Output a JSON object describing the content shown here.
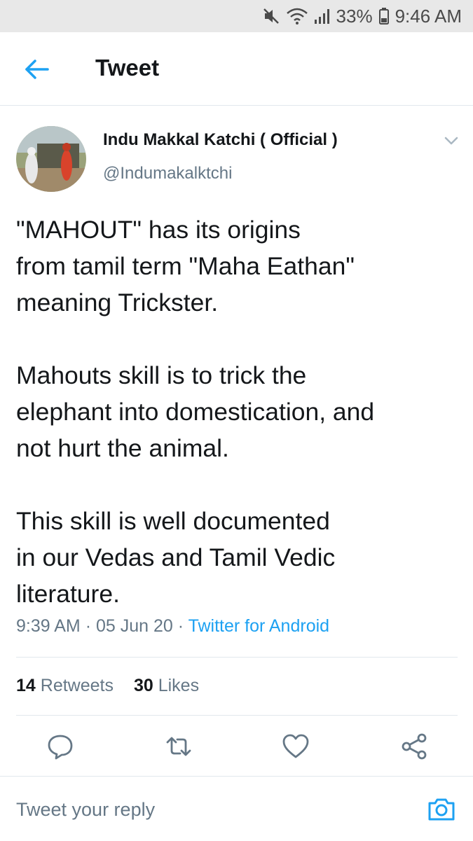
{
  "status_bar": {
    "battery": "33%",
    "time": "9:46 AM",
    "icons": [
      "mute-icon",
      "wifi-icon",
      "signal-icon",
      "battery-icon"
    ]
  },
  "header": {
    "title": "Tweet",
    "back_icon": "back-arrow-icon"
  },
  "tweet": {
    "author_name": "Indu Makkal Katchi ( Official )",
    "handle": "@Indumakalktchi",
    "paragraphs": [
      "\"MAHOUT\" has its origins\nfrom tamil term \"Maha Eathan\"\nmeaning Trickster.",
      "Mahouts skill is to trick the\nelephant into domestication, and\nnot hurt the animal.",
      "This skill is well documented\nin our Vedas and Tamil Vedic\nliterature."
    ],
    "time": "9:39 AM",
    "date": "05 Jun 20",
    "separator": "·",
    "source": "Twitter for Android",
    "retweets_count": "14",
    "retweets_label": "Retweets",
    "likes_count": "30",
    "likes_label": "Likes"
  },
  "actions": [
    "reply-icon",
    "retweet-icon",
    "like-icon",
    "share-icon"
  ],
  "reply_bar": {
    "placeholder": "Tweet your reply",
    "camera_icon": "camera-icon"
  },
  "colors": {
    "accent": "#1da1f2",
    "text": "#14171a",
    "muted": "#657786",
    "divider": "#e1e8ed",
    "status_bar": "#e8e8e8"
  }
}
